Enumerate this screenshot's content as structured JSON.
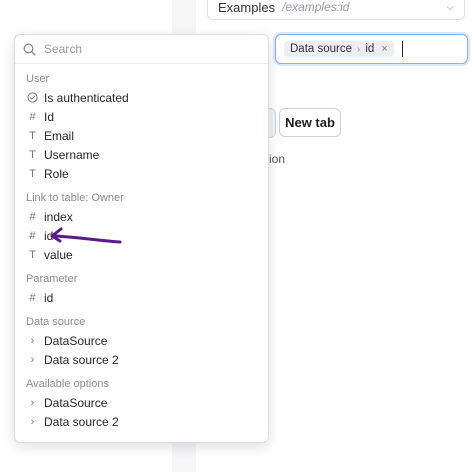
{
  "route_select": {
    "name": "Examples",
    "path": "/examples:id"
  },
  "binding": {
    "source": "Data source",
    "field": "id"
  },
  "buttons": {
    "new_tab": "New tab"
  },
  "partial_text": "ion",
  "dropdown": {
    "search_placeholder": "Search",
    "groups": {
      "user": {
        "label": "User",
        "items": [
          {
            "icon": "check-circle-icon",
            "label": "Is authenticated"
          },
          {
            "icon": "hash-icon",
            "label": "Id"
          },
          {
            "icon": "text-type-icon",
            "label": "Email"
          },
          {
            "icon": "text-type-icon",
            "label": "Username"
          },
          {
            "icon": "text-type-icon",
            "label": "Role"
          }
        ]
      },
      "owner": {
        "label": "Link to table: Owner",
        "items": [
          {
            "icon": "hash-icon",
            "label": "index"
          },
          {
            "icon": "hash-icon",
            "label": "id"
          },
          {
            "icon": "text-type-icon",
            "label": "value"
          }
        ]
      },
      "parameter": {
        "label": "Parameter",
        "items": [
          {
            "icon": "hash-icon",
            "label": "id"
          }
        ]
      },
      "data_source": {
        "label": "Data source",
        "items": [
          {
            "icon": "chevron-right-icon",
            "label": "DataSource"
          },
          {
            "icon": "chevron-right-icon",
            "label": "Data source 2"
          }
        ]
      },
      "available": {
        "label": "Available options",
        "items": [
          {
            "icon": "chevron-right-icon",
            "label": "DataSource"
          },
          {
            "icon": "chevron-right-icon",
            "label": "Data source 2"
          }
        ]
      }
    }
  },
  "colors": {
    "annotation_arrow": "#5b1a8a",
    "focus_border": "#8ab1e8"
  }
}
